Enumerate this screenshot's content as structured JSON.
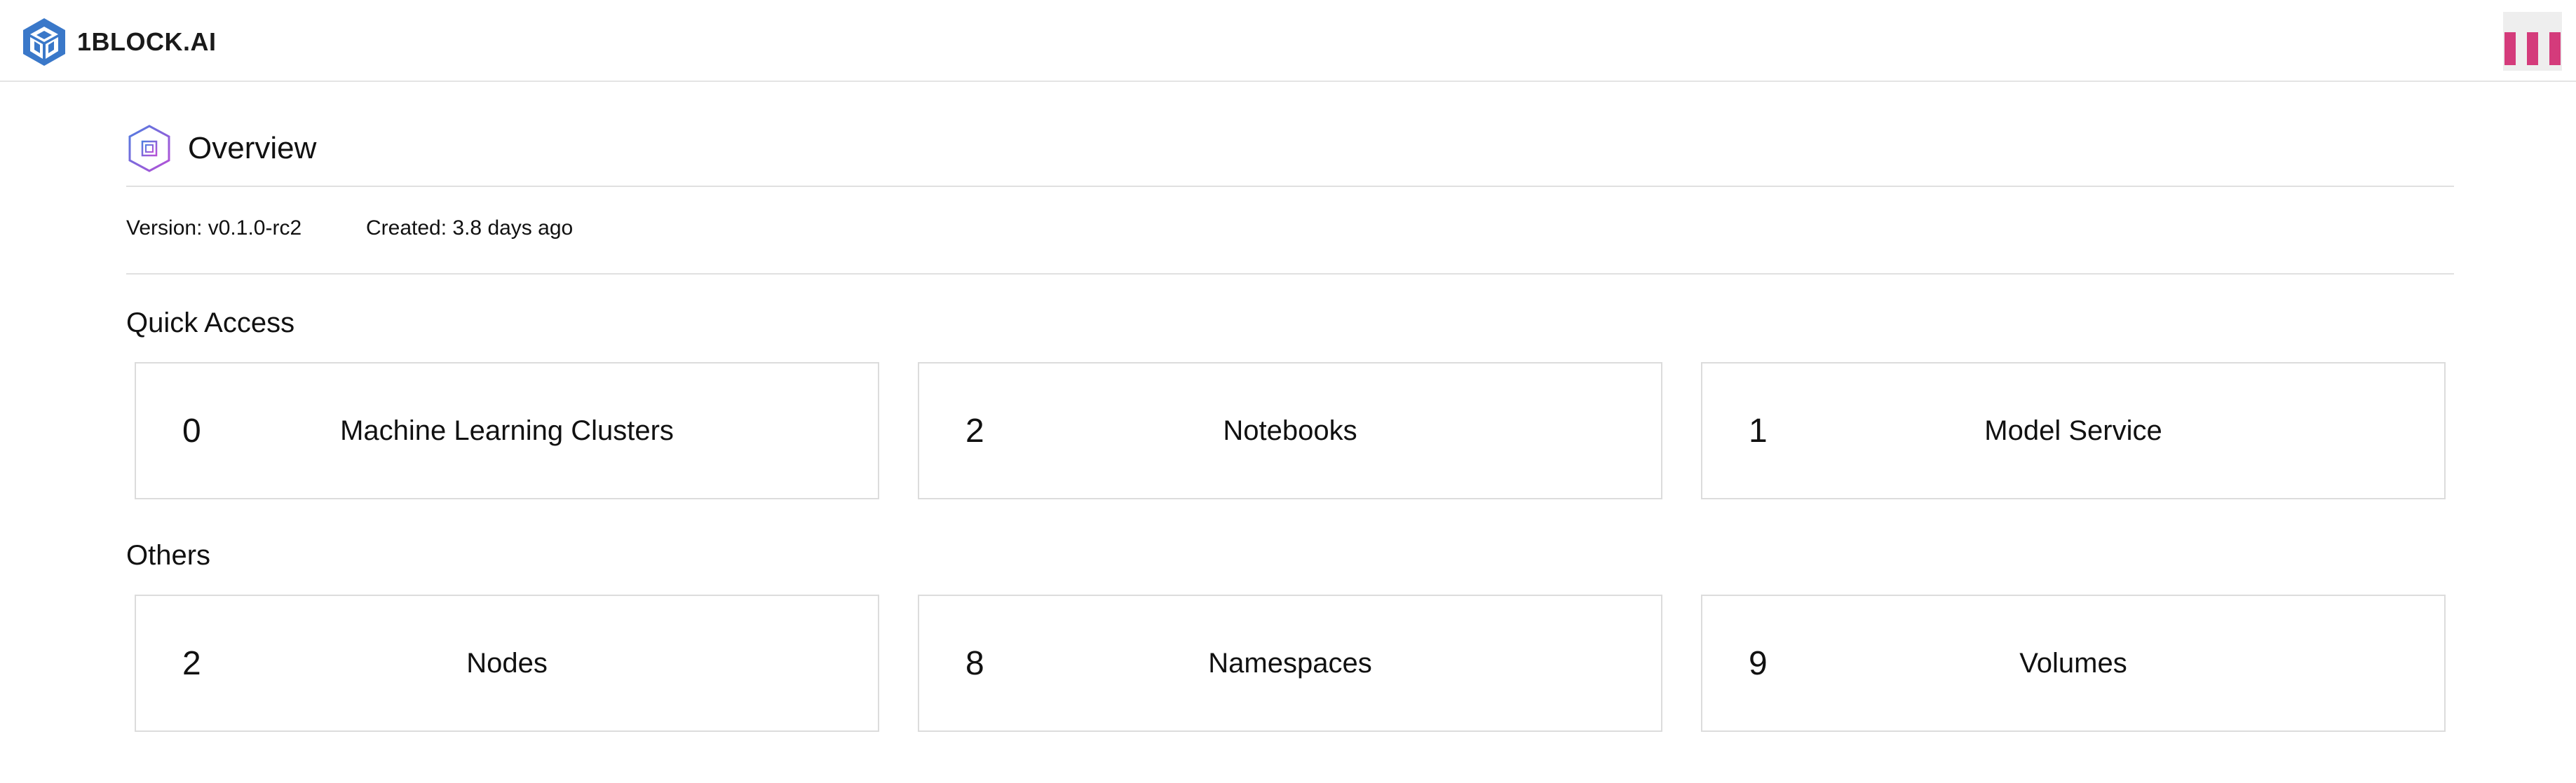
{
  "header": {
    "brand_name": "1BLOCK.AI",
    "logo_icon": "cube-logo-icon",
    "menu_icon": "bars-menu-icon",
    "accent_color": "#d43b7b",
    "logo_color": "#3a78c9"
  },
  "overview": {
    "title": "Overview",
    "icon": "chip-hexagon-icon",
    "version": "Version: v0.1.0-rc2",
    "created": "Created: 3.8 days ago"
  },
  "quick_access": {
    "title": "Quick Access",
    "cards": [
      {
        "count": "0",
        "label": "Machine Learning Clusters"
      },
      {
        "count": "2",
        "label": "Notebooks"
      },
      {
        "count": "1",
        "label": "Model Service"
      }
    ]
  },
  "others": {
    "title": "Others",
    "cards": [
      {
        "count": "2",
        "label": "Nodes"
      },
      {
        "count": "8",
        "label": "Namespaces"
      },
      {
        "count": "9",
        "label": "Volumes"
      }
    ]
  }
}
